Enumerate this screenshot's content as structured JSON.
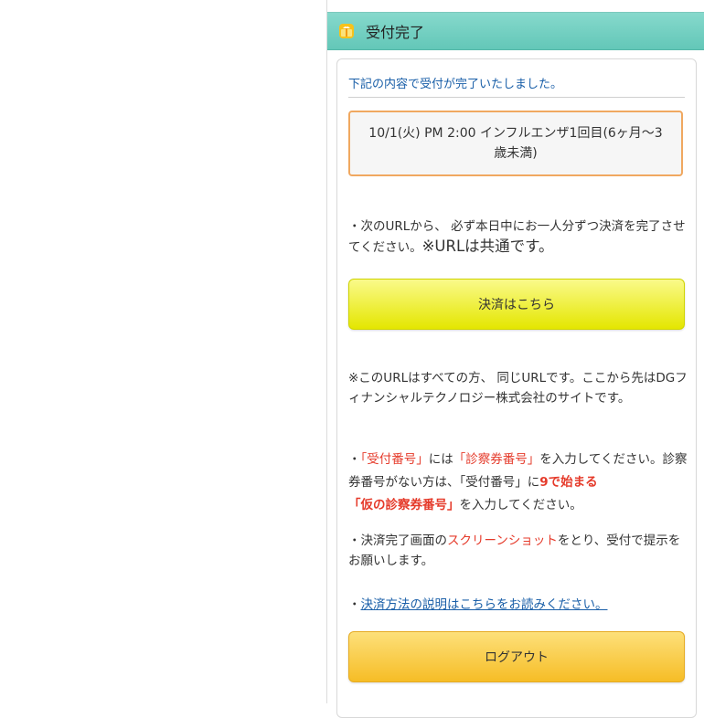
{
  "header": {
    "title": "受付完了",
    "icon": "gift-box-icon"
  },
  "intro": "下記の内容で受付が完了いたしました。",
  "reservation": {
    "text": "10/1(火) PM 2:00 インフルエンザ1回目(6ヶ月〜3歳未満)"
  },
  "payment_notice": {
    "text": "・次のURLから、 必ず本日中にお一人分ずつ決済を完了させてください。",
    "emphasis": "※URLは共通です。"
  },
  "pay_button": "決済はこちら",
  "url_notice": "※このURLはすべての方、 同じURLです。ここから先はDGフィナンシャルテクノロジー株式会社のサイトです。",
  "id_notice": {
    "prefix": "・",
    "reception_number": "「受付番号」",
    "mid1": "には",
    "exam_card_number": "「診察券番号」",
    "mid2": "を入力してください。診察券番号がない方は、「受付番号」に",
    "starts_with_9": "9で始まる",
    "temp_number": "「仮の診察券番号」",
    "suffix": "を入力してください。"
  },
  "screenshot_notice": {
    "prefix": "・決済完了画面の",
    "highlight": "スクリーンショット",
    "suffix": "をとり、受付で提示をお願いします。"
  },
  "help": {
    "prefix": "・",
    "link": "決済方法の説明はこちらをお読みください。"
  },
  "logout_button": "ログアウト",
  "colors": {
    "header": "#63c7b8",
    "pay_button": "#e4e600",
    "logout_button": "#f6bd26",
    "highlight_red": "#e53a2a",
    "link_blue": "#1a5fa8",
    "reservation_border": "#f0a860"
  }
}
